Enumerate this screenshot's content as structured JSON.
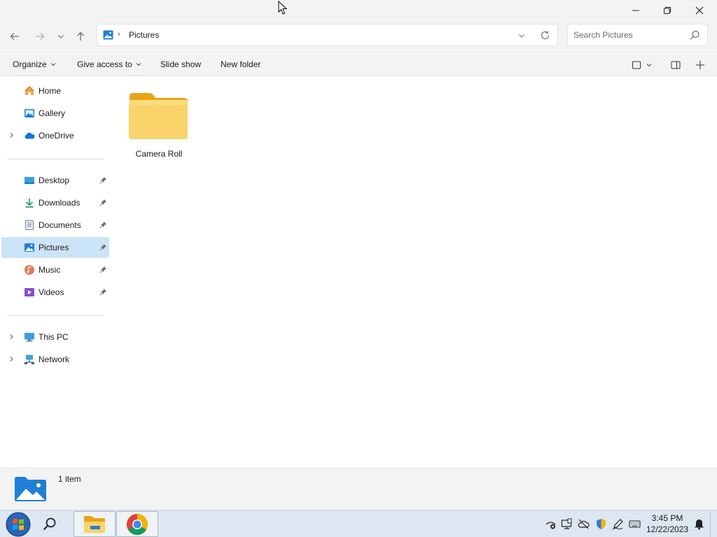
{
  "window": {
    "minimize_icon": "minimize-icon",
    "maximize_icon": "restore-icon",
    "close_icon": "close-icon"
  },
  "nav": {
    "back_icon": "arrow-left-icon",
    "forward_icon": "arrow-right-icon",
    "recent_icon": "chevron-down-icon",
    "up_icon": "arrow-up-icon"
  },
  "address": {
    "folder_icon": "pictures-folder-icon",
    "path": "Pictures",
    "dropdown_icon": "chevron-down-icon",
    "refresh_icon": "refresh-icon"
  },
  "search": {
    "placeholder": "Search Pictures",
    "value": "",
    "icon": "search-icon"
  },
  "commands": {
    "organize": "Organize",
    "give_access": "Give access to",
    "slideshow": "Slide show",
    "new_folder": "New folder"
  },
  "sidebar": {
    "items": [
      {
        "label": "Home",
        "icon": "home-icon"
      },
      {
        "label": "Gallery",
        "icon": "gallery-icon"
      },
      {
        "label": "OneDrive",
        "icon": "onedrive-icon"
      },
      {
        "label": "Desktop",
        "icon": "desktop-icon"
      },
      {
        "label": "Downloads",
        "icon": "download-icon"
      },
      {
        "label": "Documents",
        "icon": "document-icon"
      },
      {
        "label": "Pictures",
        "icon": "pictures-icon"
      },
      {
        "label": "Music",
        "icon": "music-icon"
      },
      {
        "label": "Videos",
        "icon": "videos-icon"
      },
      {
        "label": "This PC",
        "icon": "computer-icon"
      },
      {
        "label": "Network",
        "icon": "network-icon"
      }
    ],
    "selected": "Pictures"
  },
  "content": {
    "items": [
      {
        "name": "Camera Roll",
        "type": "folder"
      }
    ]
  },
  "status": {
    "count_text": "1 item"
  },
  "taskbar": {
    "apps": [
      "File Explorer",
      "Google Chrome"
    ],
    "time": "3:45 PM",
    "date": "12/22/2023"
  },
  "colors": {
    "accent": "#0078d4",
    "selection": "#cce4f7",
    "folder": "#f8c93e",
    "chrome_bg": "#f3f3f3",
    "taskbar": "#dde6f1"
  }
}
